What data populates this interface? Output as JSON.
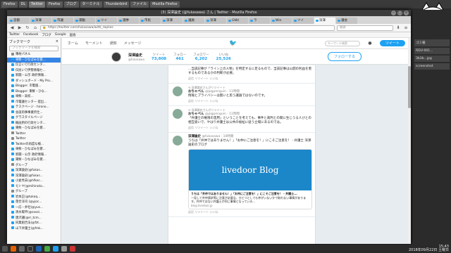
{
  "desktop_tabs": [
    "Firefox",
    "DL",
    "Twitter",
    "Firefox",
    "ブログ",
    "ターミナル",
    "Thunderbird",
    "ファイル",
    "Mozilla Firefox"
  ],
  "window": {
    "title": "(3) 深澤論史 (@fukasawa) さん | Twitter - Mozilla Firefox",
    "tabs": [
      "首都",
      "深澤",
      "市議",
      "運動",
      "ツイ",
      "選挙",
      "市民",
      "深澤",
      "議員",
      "深澤",
      "GNU",
      "ラ",
      "Win",
      "ツイ",
      "深澤",
      "議会"
    ],
    "url": "https://twitter.com/fukasawa/with_replies",
    "search_placeholder": "検索"
  },
  "bookmarks_bar": [
    "Twitter",
    "Facebook",
    "ブログ",
    "Google",
    "国会"
  ],
  "sidebar": {
    "title": "ブックマーク",
    "search_placeholder": "ブックマークを検索",
    "items": [
      {
        "label": "簿材パネル",
        "type": "folder"
      },
      {
        "label": "車鮮・ひなぱみを雑...",
        "type": "link",
        "selected": true
      },
      {
        "label": "伝言いで行政センタ...",
        "type": "link"
      },
      {
        "label": "伝民いで伊勢情報セ...",
        "type": "link"
      },
      {
        "label": "新聞・公示 政府情報...",
        "type": "link"
      },
      {
        "label": "ダッシュボード - My Pro...",
        "type": "link"
      },
      {
        "label": "Blogger: 市電版...",
        "type": "link"
      },
      {
        "label": "Blogger: 東鮮・ひな...",
        "type": "link"
      },
      {
        "label": "車鮮・高校...",
        "type": "link"
      },
      {
        "label": "市電議センター 提出...",
        "type": "link"
      },
      {
        "label": "テスクベージ - hirono...",
        "type": "link"
      },
      {
        "label": "会談的事事業所仕...",
        "type": "link"
      },
      {
        "label": "グラスタイルページ",
        "type": "link"
      },
      {
        "label": "概画用の行政センタ...",
        "type": "link"
      },
      {
        "label": "東鮮・ひなぱみを雑...",
        "type": "link"
      },
      {
        "label": "Twitter",
        "type": "folder"
      },
      {
        "label": "Twitter",
        "type": "folder"
      },
      {
        "label": "Twitterの再度な検...",
        "type": "link"
      },
      {
        "label": "車鮮・ひなぱみを雑...",
        "type": "link"
      },
      {
        "label": "新聞・公示 政府情報...",
        "type": "link"
      },
      {
        "label": "東鮮・ひなぱみを雑...",
        "type": "link"
      },
      {
        "label": "グループ",
        "type": "folder"
      },
      {
        "label": "深澤論史(@fukas...",
        "type": "link"
      },
      {
        "label": "深澤論史(@fukas...",
        "type": "link"
      },
      {
        "label": "小倉秀夫(@hfkoc...",
        "type": "link"
      },
      {
        "label": "モトヤ(@mihinoto...",
        "type": "link"
      },
      {
        "label": "グループ",
        "type": "folder"
      },
      {
        "label": "岩本正(@tukaq...",
        "type": "link"
      },
      {
        "label": "落合洋司 (@yjoc...",
        "type": "link"
      },
      {
        "label": "一応・弁社(@yus...",
        "type": "link"
      },
      {
        "label": "清水陽平(@sosei...",
        "type": "link"
      },
      {
        "label": "唐沢議(@rr_tcm...",
        "type": "link"
      },
      {
        "label": "同業組合法(@fzt...",
        "type": "link"
      },
      {
        "label": "山下弁護士(@fmk...",
        "type": "link"
      }
    ]
  },
  "twitter_nav": {
    "items": [
      "ホーム",
      "モーメント",
      "通知",
      "メッセージ"
    ],
    "search_placeholder": "キーワード検索",
    "tweet_button": "ツイート"
  },
  "profile": {
    "name": "深澤論史",
    "handle": "@fukasawa",
    "stats": [
      {
        "label": "ツイート",
        "value": "73,808"
      },
      {
        "label": "フォロー",
        "value": "461"
      },
      {
        "label": "フォロワー",
        "value": "6,202"
      },
      {
        "label": "いいね",
        "value": "25,526"
      }
    ],
    "follow_button": "フォローする"
  },
  "tweets": [
    {
      "retweet_note": "",
      "name": "",
      "handle": "",
      "text": "...当該記事が「ライン上の人物」を特定するに足るもので、当該記事は公開の利益を害するものであるかの判断が必要。",
      "actions": "返信  リツイート  いいね"
    },
    {
      "retweet_note": "深澤論史さんがリツイート",
      "name": "おちゃぺん",
      "handle": "@pigpenguin · 11時間",
      "text": "情報とプライバシーは無いと思う議論ではないのです。",
      "actions": "返信  リツイート  いいね"
    },
    {
      "retweet_note": "深澤論史さんがリツイート",
      "name": "おちゃぺん",
      "handle": "@pigpenguin · 11時間",
      "text": "「弁護士の権限の濫用」ということを考えても、事件と裁判との間に生じうる人びとの相互扱いで、やはり弁護士は公共の福祉に従う立場にあるのでは。",
      "actions": "返信  リツイート  いいね"
    },
    {
      "retweet_note": "",
      "name": "深澤論史",
      "handle": "@fukasawa · 10時間",
      "text": "うちは「弁仲ではありません！」「お仲にご注意を！」にこそご注意を！ - 弁護士 深澤論史のブログ",
      "actions": "返信  リツイート  いいね"
    }
  ],
  "link_card": {
    "brand": "livedoor Blog",
    "title": "うちは「弁仲ではありません！」「お仲にご注意を！」にこそご注意を！ - 弁護士...",
    "desc": "一見して弁仲請求等に注意が必要な、ひとつとしても仲がいないかで取れない事情があります。弁仲ではない弁護士が同じ事情となっている...",
    "domain": "blog.livedoor.jp"
  },
  "right_panel": [
    "ゴミ箱",
    "RDU-001...",
    "3b3b...jpg",
    "screenshot"
  ],
  "clock": {
    "time": "15:43",
    "date": "2018年09月22日 土曜日"
  }
}
